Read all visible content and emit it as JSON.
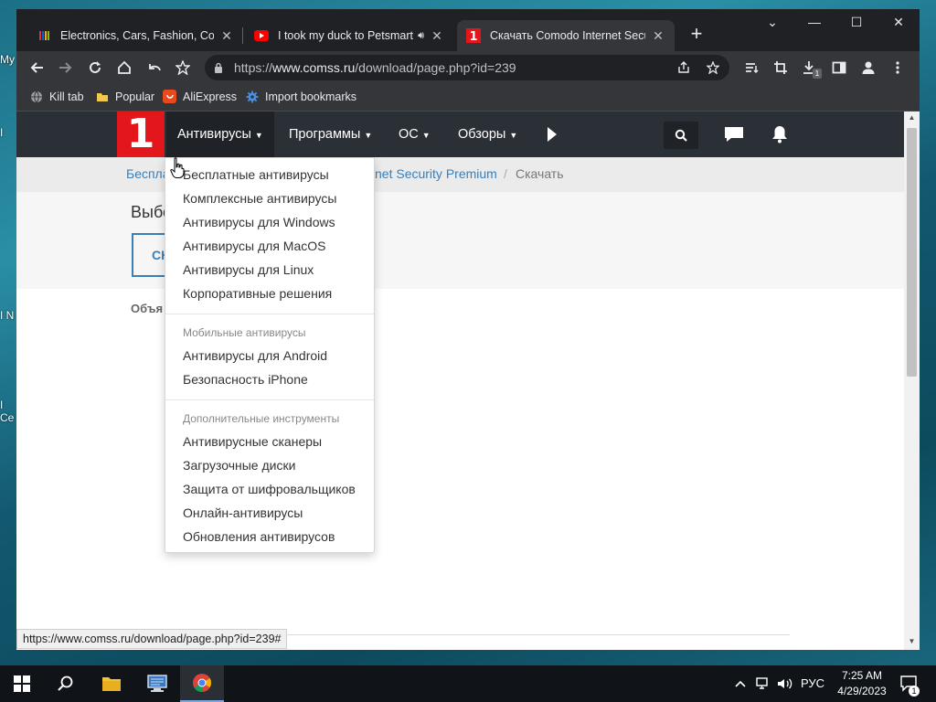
{
  "desktop": {
    "fragments": [
      "My",
      "I",
      "I N",
      "I Ce"
    ]
  },
  "browser": {
    "tabs": [
      {
        "title": "Electronics, Cars, Fashion, Collect",
        "close": "✕"
      },
      {
        "title": "I took my duck to Petsmart -",
        "close": "✕"
      },
      {
        "title": "Скачать Comodo Internet Secur",
        "close": "✕"
      }
    ],
    "newtab": "+",
    "window_controls": {
      "dropdown": "⌄",
      "minimize": "—",
      "maximize": "☐",
      "close": "✕"
    },
    "url": {
      "prefix": "https://",
      "host": "www.comss.ru",
      "path": "/download/page.php?id=239"
    },
    "download_badge": "1",
    "bookmarks": [
      {
        "label": "Kill tab",
        "icon": "globe-icon"
      },
      {
        "label": "Popular",
        "icon": "folder-icon"
      },
      {
        "label": "AliExpress",
        "icon": "aliexpress-icon"
      },
      {
        "label": "Import bookmarks",
        "icon": "gear-icon"
      }
    ],
    "status_url": "https://www.comss.ru/download/page.php?id=239#"
  },
  "site": {
    "logo": "1",
    "nav": [
      {
        "label": "Антивирусы",
        "active": true
      },
      {
        "label": "Программы"
      },
      {
        "label": "ОС"
      },
      {
        "label": "Обзоры"
      }
    ],
    "breadcrumb": {
      "first": "Беспла",
      "second": "net Security Premium",
      "sep": "/",
      "current": "Скачать"
    },
    "select_heading": "Выбе",
    "download_button": "СК",
    "objects_label": "Объя",
    "dropdown": {
      "group1": [
        "Бесплатные антивирусы",
        "Комплексные антивирусы",
        "Антивирусы для Windows",
        "Антивирусы для MacOS",
        "Антивирусы для Linux",
        "Корпоративные решения"
      ],
      "group2_title": "Мобильные антивирусы",
      "group2": [
        "Антивирусы для Android",
        "Безопасность iPhone"
      ],
      "group3_title": "Дополнительные инструменты",
      "group3": [
        "Антивирусные сканеры",
        "Загрузочные диски",
        "Защита от шифровальщиков",
        "Онлайн-антивирусы",
        "Обновления антивирусов"
      ]
    }
  },
  "taskbar": {
    "language": "РУС",
    "time": "7:25 AM",
    "date": "4/29/2023",
    "notification_count": "1"
  },
  "colors": {
    "accent_red": "#e3161b",
    "nav_bg": "#2b2f36",
    "link_blue": "#3a7fb8",
    "chrome_dark": "#202124"
  }
}
